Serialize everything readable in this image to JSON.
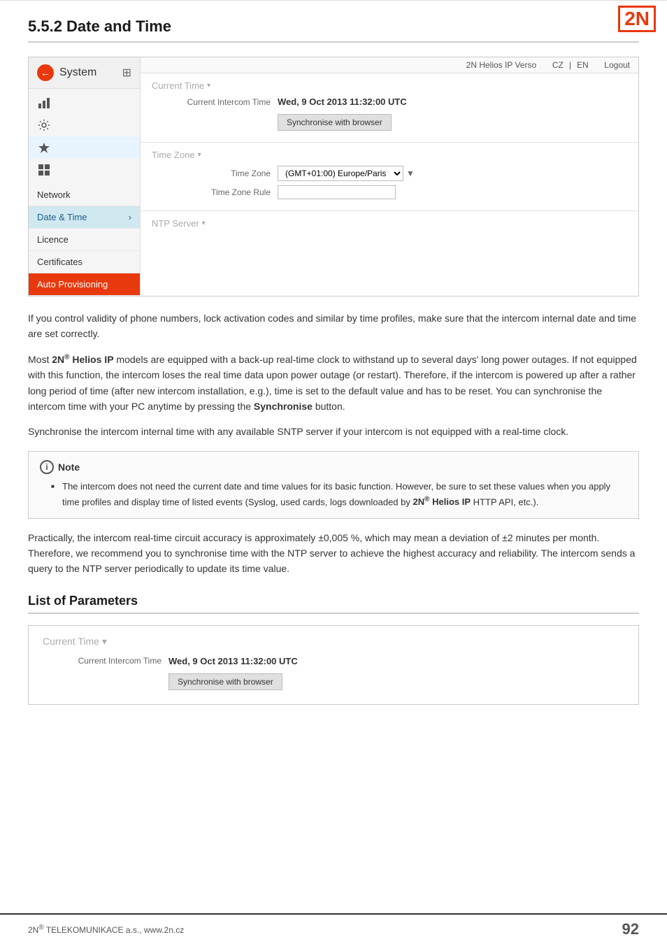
{
  "logo": "2N",
  "page_title": "5.5.2 Date and Time",
  "nav_bar": {
    "product": "2N Helios IP Verso",
    "lang_cz": "CZ",
    "lang_en": "EN",
    "logout": "Logout"
  },
  "sidebar": {
    "back_icon": "←",
    "title": "System",
    "grid_icon": "⊞",
    "icons": [
      {
        "name": "bar-chart-icon",
        "symbol": "▪",
        "label": "stats"
      },
      {
        "name": "gear-icon",
        "symbol": "⚙",
        "label": "settings"
      },
      {
        "name": "star-icon",
        "symbol": "✦",
        "label": "features"
      },
      {
        "name": "grid2-icon",
        "symbol": "⊞",
        "label": "modules"
      }
    ],
    "menu_items": [
      {
        "label": "Network",
        "active": false
      },
      {
        "label": "Date & Time",
        "active": true
      },
      {
        "label": "Licence",
        "active": false
      },
      {
        "label": "Certificates",
        "active": false
      },
      {
        "label": "Auto Provisioning",
        "active": false
      }
    ]
  },
  "current_time_section": {
    "label": "Current Time",
    "arrow": "▾",
    "current_intercom_time_label": "Current Intercom Time",
    "current_intercom_time_value": "Wed, 9 Oct 2013 11:32:00 UTC",
    "sync_button": "Synchronise with browser"
  },
  "time_zone_section": {
    "label": "Time Zone",
    "arrow": "▾",
    "timezone_label": "Time Zone",
    "timezone_value": "(GMT+01:00) Europe/Paris",
    "timezone_rule_label": "Time Zone Rule",
    "timezone_rule_value": ""
  },
  "ntp_section": {
    "label": "NTP Server",
    "arrow": "▾"
  },
  "body_paragraphs": [
    "If you control validity of phone numbers, lock activation codes and similar by time profiles, make sure that the intercom internal date and time are set correctly.",
    "Most 2N® Helios IP models are equipped with a back-up real-time clock to withstand up to several days' long power outages. If not equipped with this function, the intercom loses the real time data upon power outage (or restart). Therefore, if the intercom is powered up after a rather long period of time (after new intercom installation, e.g.), time is set to the default value and has to be reset. You can synchronise the intercom time with your PC anytime by pressing the Synchronise button.",
    "Synchronise the intercom internal time with any available SNTP server if your intercom is not equipped with a real-time clock."
  ],
  "note": {
    "title": "Note",
    "icon_char": "i",
    "bullets": [
      "The intercom does not need the current date and time values for its basic function. However, be sure to set these values when you apply time profiles and display time of listed events (Syslog, used cards, logs downloaded by 2N® Helios IP HTTP API, etc.)."
    ]
  },
  "body_paragraph_last": "Practically, the intercom real-time circuit accuracy is approximately ±0,005 %, which may mean a deviation of ±2 minutes per month. Therefore, we recommend you to synchronise time with the NTP server to achieve the highest accuracy and reliability. The intercom sends a query to the NTP server periodically to update its time value.",
  "list_of_parameters": {
    "title": "List of Parameters",
    "current_time_label": "Current Time",
    "current_time_arrow": "▾",
    "current_intercom_time_label": "Current Intercom Time",
    "current_intercom_time_value": "Wed, 9 Oct 2013 11:32:00 UTC",
    "sync_button": "Synchronise with browser"
  },
  "footer": {
    "left": "2N® TELEKOMUNIKACE a.s., www.2n.cz",
    "right": "92"
  }
}
